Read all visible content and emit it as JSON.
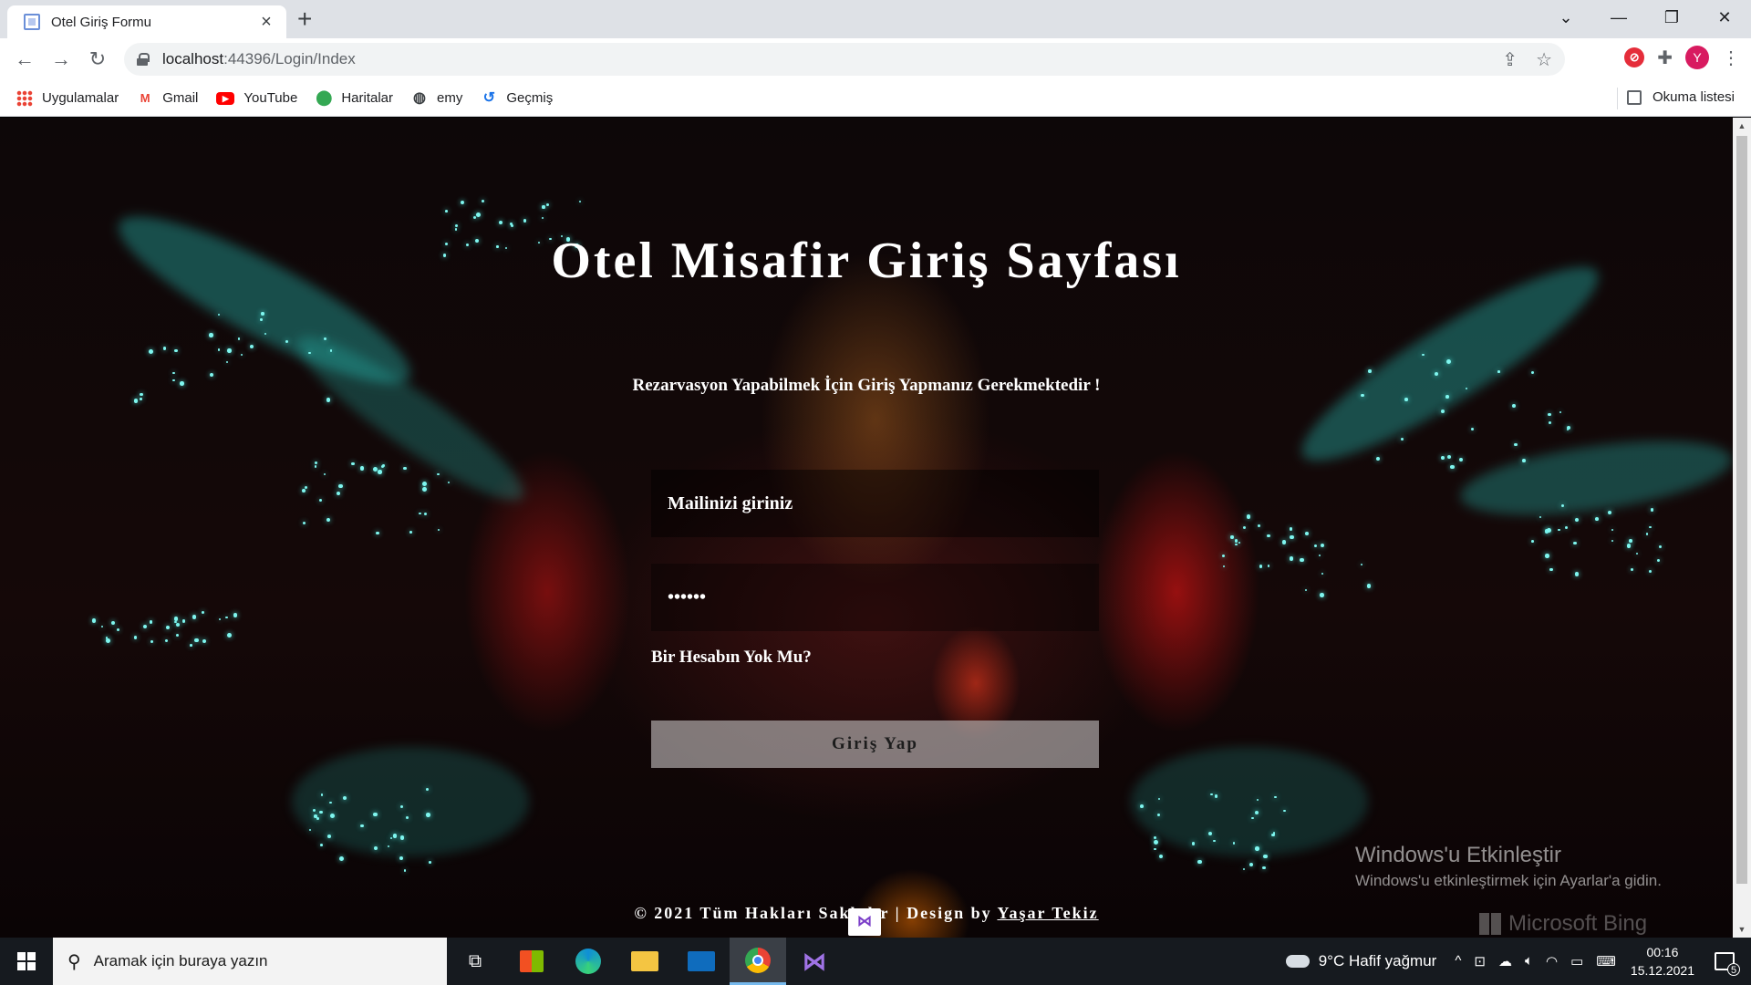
{
  "browser": {
    "tab_title": "Otel Giriş Formu",
    "url_host": "localhost",
    "url_path": ":44396/Login/Index",
    "avatar_letter": "Y",
    "bookmarks": [
      {
        "label": "Uygulamalar",
        "icon": "apps-icon"
      },
      {
        "label": "Gmail",
        "icon": "gmail-icon"
      },
      {
        "label": "YouTube",
        "icon": "youtube-icon"
      },
      {
        "label": "Haritalar",
        "icon": "maps-icon"
      },
      {
        "label": "emy",
        "icon": "globe-icon"
      },
      {
        "label": "Geçmiş",
        "icon": "history-icon"
      }
    ],
    "reading_list": "Okuma listesi"
  },
  "page": {
    "title": "Otel Misafir Giriş Sayfası",
    "subtitle": "Rezarvasyon Yapabilmek İçin Giriş Yapmanız Gerekmektedir !",
    "email_placeholder": "Mailinizi giriniz",
    "password_value": "******",
    "signup_link": "Bir Hesabın Yok Mu?",
    "login_button": "Giriş Yap",
    "footer_text": "© 2021 Tüm Hakları Saklıdır | Design by ",
    "footer_author": "Yaşar Tekiz"
  },
  "overlay": {
    "activate_title": "Windows'u Etkinleştir",
    "activate_sub": "Windows'u etkinleştirmek için Ayarlar'a gidin.",
    "bing": "Microsoft Bing"
  },
  "taskbar": {
    "search_placeholder": "Aramak için buraya yazın",
    "weather": "9°C  Hafif yağmur",
    "time": "00:16",
    "date": "15.12.2021",
    "notification_count": "5"
  }
}
